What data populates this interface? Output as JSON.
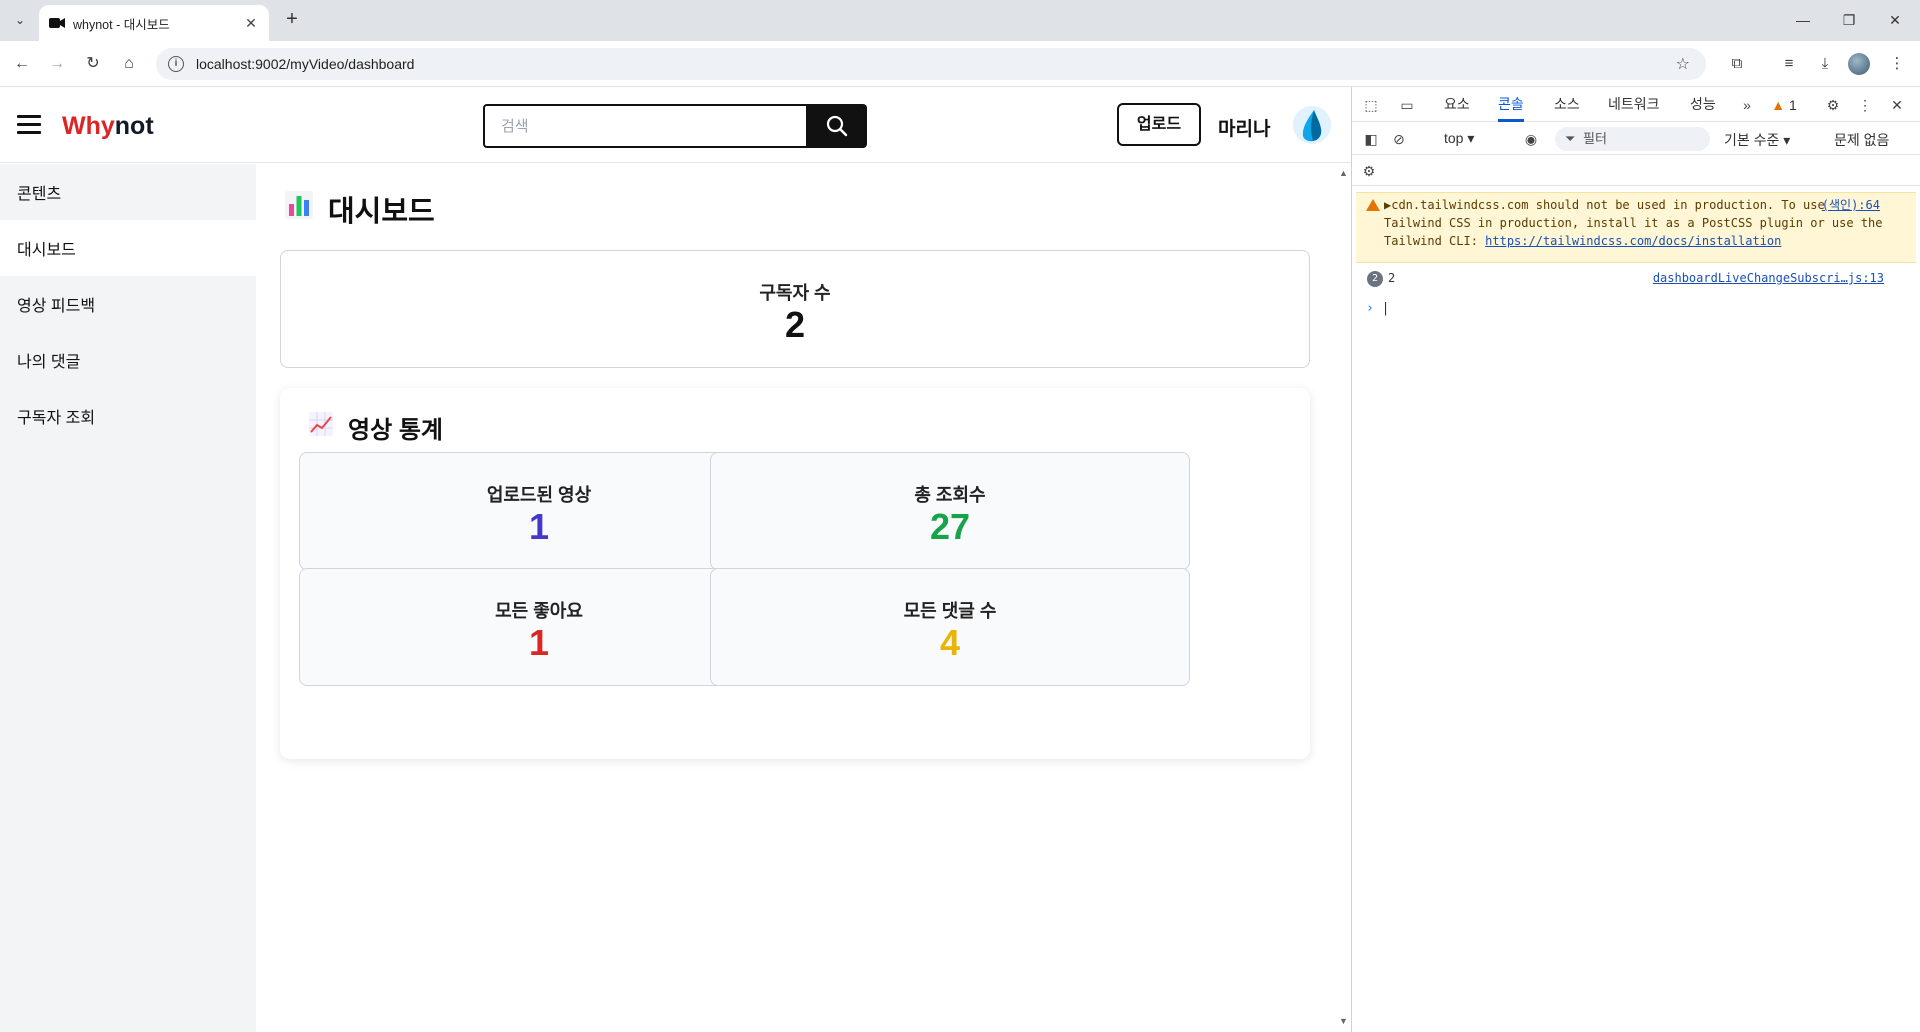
{
  "browser": {
    "tab_title": "whynot - 대시보드",
    "url": "localhost:9002/myVideo/dashboard"
  },
  "header": {
    "logo_part1": "Why",
    "logo_part2": "not",
    "search_placeholder": "검색",
    "upload_label": "업로드",
    "username": "마리나"
  },
  "sidebar": {
    "items": [
      {
        "label": "콘텐츠"
      },
      {
        "label": "대시보드"
      },
      {
        "label": "영상 피드백"
      },
      {
        "label": "나의 댓글"
      },
      {
        "label": "구독자 조회"
      }
    ],
    "active_index": 1
  },
  "dashboard": {
    "title": "대시보드",
    "subscribers_label": "구독자 수",
    "subscribers_value": "2",
    "stats_title": "영상 통계",
    "stats": [
      {
        "label": "업로드된 영상",
        "value": "1",
        "color": "#4338ca"
      },
      {
        "label": "총 조회수",
        "value": "27",
        "color": "#16a34a"
      },
      {
        "label": "모든 좋아요",
        "value": "1",
        "color": "#dc2626"
      },
      {
        "label": "모든 댓글 수",
        "value": "4",
        "color": "#eab308"
      }
    ]
  },
  "devtools": {
    "tabs": [
      "요소",
      "콘솔",
      "소스",
      "네트워크",
      "성능"
    ],
    "active_tab": "콘솔",
    "warning_badge": "1",
    "context": "top",
    "filter_placeholder": "필터",
    "level": "기본 수준",
    "issues": "문제 없음",
    "warning_text": "cdn.tailwindcss.com should not be used in production. To use Tailwind CSS in production, install it as a PostCSS plugin or use the Tailwind CLI:",
    "warning_link": "https://tailwindcss.com/docs/installation",
    "warning_source": "(색인):64",
    "log_count": "2",
    "log_value": "2",
    "log_source": "dashboardLiveChangeSubscri…js:13"
  }
}
